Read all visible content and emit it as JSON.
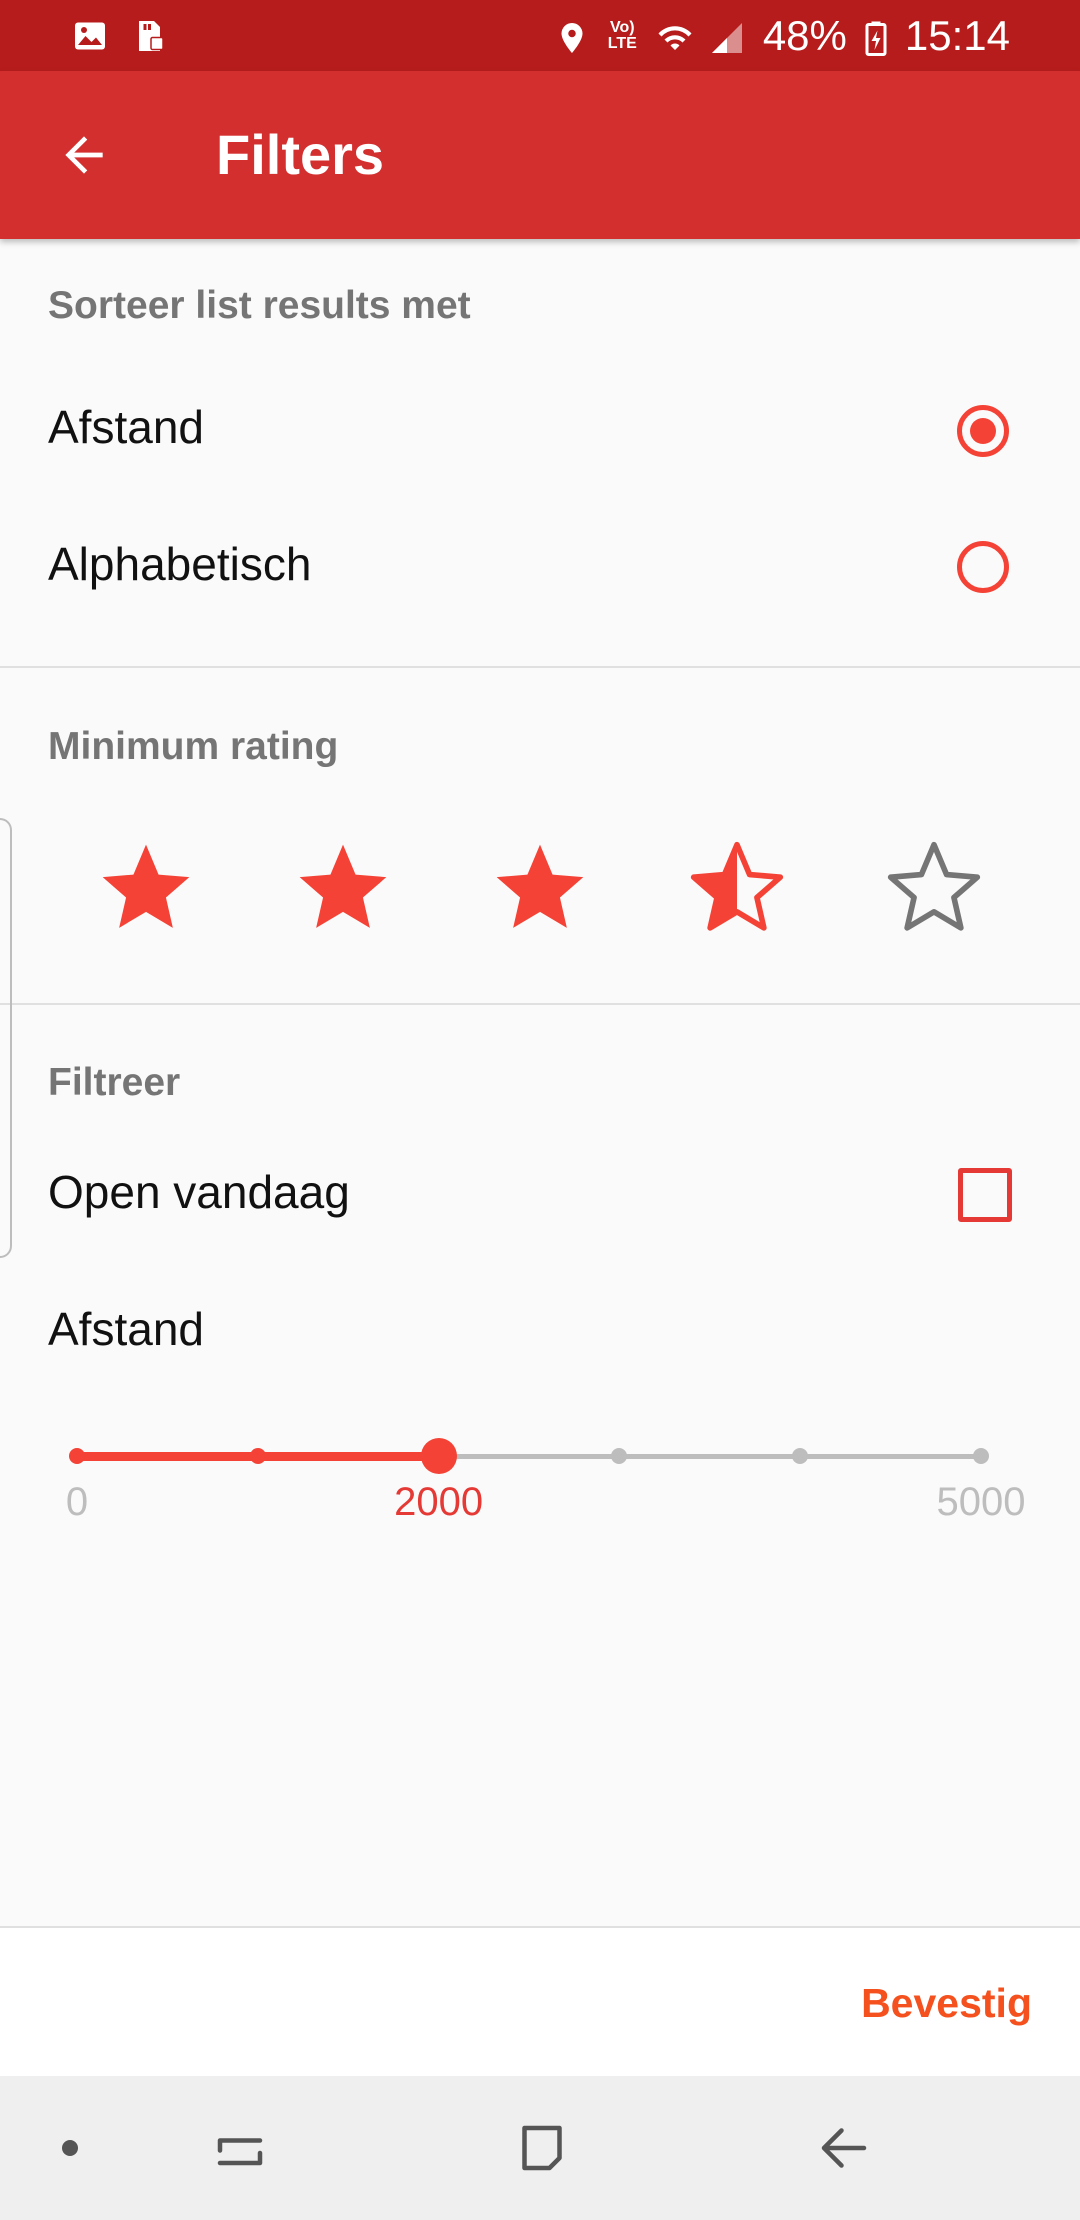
{
  "status_bar": {
    "battery": "48%",
    "time": "15:14",
    "icons": [
      "image-icon",
      "sd-card-icon",
      "location-icon",
      "volte-icon",
      "wifi-icon",
      "signal-icon",
      "battery-icon"
    ]
  },
  "app_bar": {
    "title": "Filters",
    "back_icon": "arrow-back-icon"
  },
  "sort": {
    "title": "Sorteer list results met",
    "options": [
      {
        "label": "Afstand",
        "selected": true
      },
      {
        "label": "Alphabetisch",
        "selected": false
      }
    ]
  },
  "rating": {
    "title": "Minimum rating",
    "value": 3.5,
    "max": 5
  },
  "filter": {
    "title": "Filtreer",
    "open_today": {
      "label": "Open vandaag",
      "checked": false
    },
    "distance": {
      "label": "Afstand",
      "min_label": "0",
      "value_label": "2000",
      "max_label": "5000",
      "min": 0,
      "max": 5000,
      "value": 2000,
      "steps": [
        0,
        1000,
        2000,
        3000,
        4000,
        5000
      ]
    }
  },
  "bottom_bar": {
    "confirm_label": "Bevestig"
  },
  "nav_bar": {
    "icons": [
      "dot-icon",
      "recent-apps-icon",
      "home-icon",
      "back-icon"
    ]
  },
  "colors": {
    "status_bar": "#b71c1c",
    "app_bar": "#d32f2f",
    "accent": "#f44336",
    "confirm": "#f4511e"
  }
}
